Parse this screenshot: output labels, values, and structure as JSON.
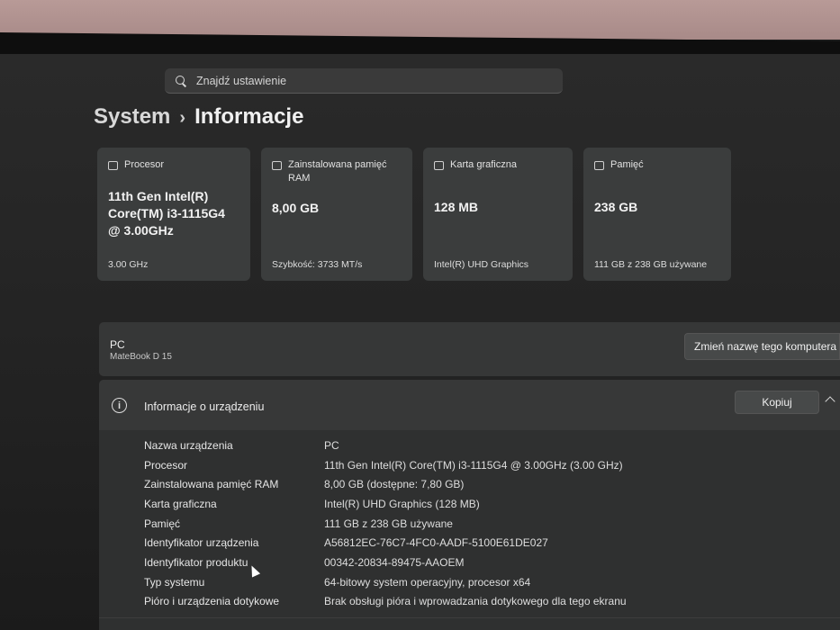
{
  "search": {
    "placeholder": "Znajdź ustawienie"
  },
  "breadcrumb": {
    "parent": "System",
    "separator": "›",
    "current": "Informacje"
  },
  "cards": [
    {
      "icon": "processor-icon",
      "title": "Procesor",
      "value": "11th Gen Intel(R) Core(TM) i3-1115G4 @ 3.00GHz",
      "sub": "3.00 GHz"
    },
    {
      "icon": "ram-icon",
      "title": "Zainstalowana pamięć RAM",
      "value": "8,00 GB",
      "sub": "Szybkość: 3733 MT/s"
    },
    {
      "icon": "graphics-card-icon",
      "title": "Karta graficzna",
      "value": "128 MB",
      "sub": "Intel(R) UHD Graphics"
    },
    {
      "icon": "storage-icon",
      "title": "Pamięć",
      "value": "238 GB",
      "sub": "111 GB z 238 GB używane"
    }
  ],
  "pc": {
    "name": "PC",
    "model": "MateBook D 15",
    "rename_label": "Zmień nazwę tego komputera"
  },
  "device_info": {
    "title": "Informacje o urządzeniu",
    "copy_label": "Kopiuj",
    "rows": [
      {
        "label": "Nazwa urządzenia",
        "value": "PC"
      },
      {
        "label": "Procesor",
        "value": "11th Gen Intel(R) Core(TM) i3-1115G4 @ 3.00GHz (3.00 GHz)"
      },
      {
        "label": "Zainstalowana pamięć RAM",
        "value": "8,00 GB (dostępne: 7,80 GB)"
      },
      {
        "label": "Karta graficzna",
        "value": "Intel(R) UHD Graphics (128 MB)"
      },
      {
        "label": "Pamięć",
        "value": "111 GB z 238 GB używane"
      },
      {
        "label": "Identyfikator urządzenia",
        "value": "A56812EC-76C7-4FC0-AADF-5100E61DE027"
      },
      {
        "label": "Identyfikator produktu",
        "value": "00342-20834-89475-AAOEM"
      },
      {
        "label": "Typ systemu",
        "value": "64-bitowy system operacyjny, procesor x64"
      },
      {
        "label": "Pióro i urządzenia dotykowe",
        "value": "Brak obsługi pióra i wprowadzania dotykowego dla tego ekranu"
      }
    ]
  }
}
